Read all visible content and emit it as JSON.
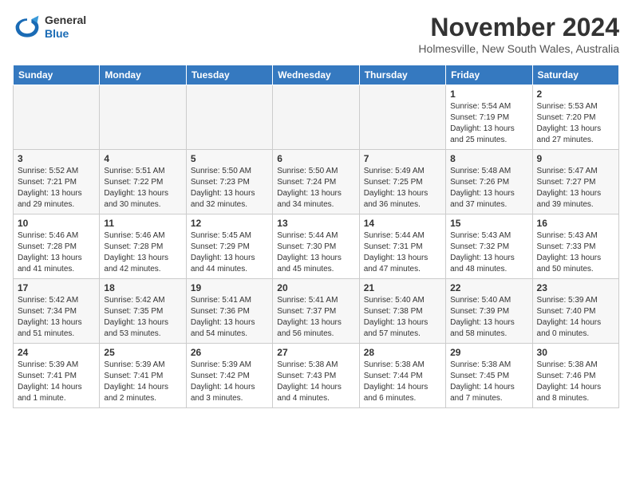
{
  "header": {
    "logo_general": "General",
    "logo_blue": "Blue",
    "month_title": "November 2024",
    "location": "Holmesville, New South Wales, Australia"
  },
  "days_of_week": [
    "Sunday",
    "Monday",
    "Tuesday",
    "Wednesday",
    "Thursday",
    "Friday",
    "Saturday"
  ],
  "weeks": [
    [
      {
        "day": "",
        "empty": true
      },
      {
        "day": "",
        "empty": true
      },
      {
        "day": "",
        "empty": true
      },
      {
        "day": "",
        "empty": true
      },
      {
        "day": "",
        "empty": true
      },
      {
        "day": "1",
        "sunrise": "Sunrise: 5:54 AM",
        "sunset": "Sunset: 7:19 PM",
        "daylight": "Daylight: 13 hours and 25 minutes."
      },
      {
        "day": "2",
        "sunrise": "Sunrise: 5:53 AM",
        "sunset": "Sunset: 7:20 PM",
        "daylight": "Daylight: 13 hours and 27 minutes."
      }
    ],
    [
      {
        "day": "3",
        "sunrise": "Sunrise: 5:52 AM",
        "sunset": "Sunset: 7:21 PM",
        "daylight": "Daylight: 13 hours and 29 minutes."
      },
      {
        "day": "4",
        "sunrise": "Sunrise: 5:51 AM",
        "sunset": "Sunset: 7:22 PM",
        "daylight": "Daylight: 13 hours and 30 minutes."
      },
      {
        "day": "5",
        "sunrise": "Sunrise: 5:50 AM",
        "sunset": "Sunset: 7:23 PM",
        "daylight": "Daylight: 13 hours and 32 minutes."
      },
      {
        "day": "6",
        "sunrise": "Sunrise: 5:50 AM",
        "sunset": "Sunset: 7:24 PM",
        "daylight": "Daylight: 13 hours and 34 minutes."
      },
      {
        "day": "7",
        "sunrise": "Sunrise: 5:49 AM",
        "sunset": "Sunset: 7:25 PM",
        "daylight": "Daylight: 13 hours and 36 minutes."
      },
      {
        "day": "8",
        "sunrise": "Sunrise: 5:48 AM",
        "sunset": "Sunset: 7:26 PM",
        "daylight": "Daylight: 13 hours and 37 minutes."
      },
      {
        "day": "9",
        "sunrise": "Sunrise: 5:47 AM",
        "sunset": "Sunset: 7:27 PM",
        "daylight": "Daylight: 13 hours and 39 minutes."
      }
    ],
    [
      {
        "day": "10",
        "sunrise": "Sunrise: 5:46 AM",
        "sunset": "Sunset: 7:28 PM",
        "daylight": "Daylight: 13 hours and 41 minutes."
      },
      {
        "day": "11",
        "sunrise": "Sunrise: 5:46 AM",
        "sunset": "Sunset: 7:28 PM",
        "daylight": "Daylight: 13 hours and 42 minutes."
      },
      {
        "day": "12",
        "sunrise": "Sunrise: 5:45 AM",
        "sunset": "Sunset: 7:29 PM",
        "daylight": "Daylight: 13 hours and 44 minutes."
      },
      {
        "day": "13",
        "sunrise": "Sunrise: 5:44 AM",
        "sunset": "Sunset: 7:30 PM",
        "daylight": "Daylight: 13 hours and 45 minutes."
      },
      {
        "day": "14",
        "sunrise": "Sunrise: 5:44 AM",
        "sunset": "Sunset: 7:31 PM",
        "daylight": "Daylight: 13 hours and 47 minutes."
      },
      {
        "day": "15",
        "sunrise": "Sunrise: 5:43 AM",
        "sunset": "Sunset: 7:32 PM",
        "daylight": "Daylight: 13 hours and 48 minutes."
      },
      {
        "day": "16",
        "sunrise": "Sunrise: 5:43 AM",
        "sunset": "Sunset: 7:33 PM",
        "daylight": "Daylight: 13 hours and 50 minutes."
      }
    ],
    [
      {
        "day": "17",
        "sunrise": "Sunrise: 5:42 AM",
        "sunset": "Sunset: 7:34 PM",
        "daylight": "Daylight: 13 hours and 51 minutes."
      },
      {
        "day": "18",
        "sunrise": "Sunrise: 5:42 AM",
        "sunset": "Sunset: 7:35 PM",
        "daylight": "Daylight: 13 hours and 53 minutes."
      },
      {
        "day": "19",
        "sunrise": "Sunrise: 5:41 AM",
        "sunset": "Sunset: 7:36 PM",
        "daylight": "Daylight: 13 hours and 54 minutes."
      },
      {
        "day": "20",
        "sunrise": "Sunrise: 5:41 AM",
        "sunset": "Sunset: 7:37 PM",
        "daylight": "Daylight: 13 hours and 56 minutes."
      },
      {
        "day": "21",
        "sunrise": "Sunrise: 5:40 AM",
        "sunset": "Sunset: 7:38 PM",
        "daylight": "Daylight: 13 hours and 57 minutes."
      },
      {
        "day": "22",
        "sunrise": "Sunrise: 5:40 AM",
        "sunset": "Sunset: 7:39 PM",
        "daylight": "Daylight: 13 hours and 58 minutes."
      },
      {
        "day": "23",
        "sunrise": "Sunrise: 5:39 AM",
        "sunset": "Sunset: 7:40 PM",
        "daylight": "Daylight: 14 hours and 0 minutes."
      }
    ],
    [
      {
        "day": "24",
        "sunrise": "Sunrise: 5:39 AM",
        "sunset": "Sunset: 7:41 PM",
        "daylight": "Daylight: 14 hours and 1 minute."
      },
      {
        "day": "25",
        "sunrise": "Sunrise: 5:39 AM",
        "sunset": "Sunset: 7:41 PM",
        "daylight": "Daylight: 14 hours and 2 minutes."
      },
      {
        "day": "26",
        "sunrise": "Sunrise: 5:39 AM",
        "sunset": "Sunset: 7:42 PM",
        "daylight": "Daylight: 14 hours and 3 minutes."
      },
      {
        "day": "27",
        "sunrise": "Sunrise: 5:38 AM",
        "sunset": "Sunset: 7:43 PM",
        "daylight": "Daylight: 14 hours and 4 minutes."
      },
      {
        "day": "28",
        "sunrise": "Sunrise: 5:38 AM",
        "sunset": "Sunset: 7:44 PM",
        "daylight": "Daylight: 14 hours and 6 minutes."
      },
      {
        "day": "29",
        "sunrise": "Sunrise: 5:38 AM",
        "sunset": "Sunset: 7:45 PM",
        "daylight": "Daylight: 14 hours and 7 minutes."
      },
      {
        "day": "30",
        "sunrise": "Sunrise: 5:38 AM",
        "sunset": "Sunset: 7:46 PM",
        "daylight": "Daylight: 14 hours and 8 minutes."
      }
    ]
  ],
  "row_classes": [
    "row-light",
    "row-dark",
    "row-light",
    "row-dark",
    "row-light"
  ]
}
